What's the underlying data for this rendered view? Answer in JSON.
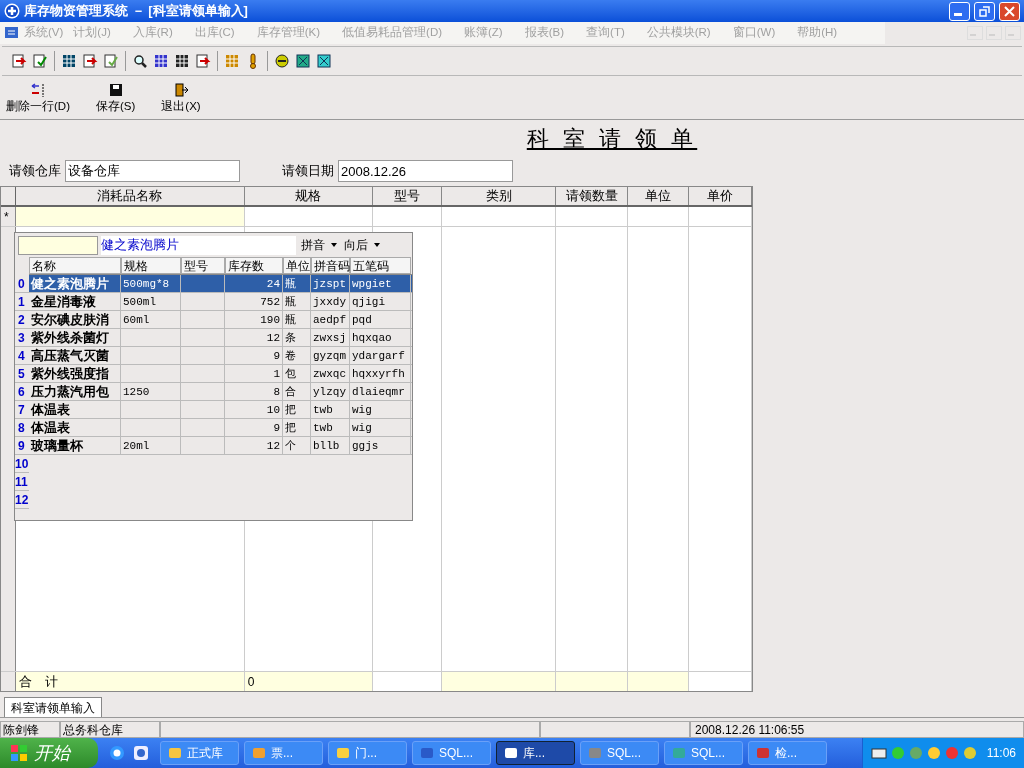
{
  "window": {
    "title": "库存物资管理系统 － [科室请领单输入]"
  },
  "menu": [
    "系统(V)",
    "计划(J)",
    "入库(R)",
    "出库(C)",
    "库存管理(K)",
    "低值易耗品管理(D)",
    "账簿(Z)",
    "报表(B)",
    "查询(T)",
    "公共模块(R)",
    "窗口(W)",
    "帮助(H)"
  ],
  "actions": [
    "删除一行(D)",
    "保存(S)",
    "退出(X)"
  ],
  "form": {
    "title": "科 室 请 领 单",
    "fields": [
      {
        "label": "请领仓库",
        "value": "设备仓库"
      },
      {
        "label": "请领日期",
        "value": "2008.12.26"
      }
    ]
  },
  "grid": {
    "columns": [
      "消耗品名称",
      "规格",
      "型号",
      "类别",
      "请领数量",
      "单位",
      "单价"
    ],
    "new_row_marker": "*",
    "total_label": "合　计",
    "total_value": "0"
  },
  "lookup": {
    "selected_name": "健之素泡腾片",
    "dropdowns": [
      "拼音",
      "向后"
    ],
    "columns": [
      "名称",
      "规格",
      "型号",
      "库存数",
      "单位",
      "拼音码",
      "五笔码"
    ],
    "rows": [
      {
        "index": "0",
        "selected": true,
        "cells": [
          "健之素泡腾片",
          "500mg*8",
          "",
          "24",
          "瓶",
          "jzspt",
          "wpgiet"
        ]
      },
      {
        "index": "1",
        "selected": false,
        "cells": [
          "金星消毒液",
          "500ml",
          "",
          "752",
          "瓶",
          "jxxdy",
          "qjigi"
        ]
      },
      {
        "index": "2",
        "selected": false,
        "cells": [
          "安尔碘皮肤消",
          "60ml",
          "",
          "190",
          "瓶",
          "aedpf",
          "pqd"
        ]
      },
      {
        "index": "3",
        "selected": false,
        "cells": [
          "紫外线杀菌灯",
          "",
          "",
          "12",
          "条",
          "zwxsj",
          "hqxqao"
        ]
      },
      {
        "index": "4",
        "selected": false,
        "cells": [
          "高压蒸气灭菌",
          "",
          "",
          "9",
          "卷",
          "gyzqm",
          "ydargarf"
        ]
      },
      {
        "index": "5",
        "selected": false,
        "cells": [
          "紫外线强度指",
          "",
          "",
          "1",
          "包",
          "zwxqc",
          "hqxxyrfh"
        ]
      },
      {
        "index": "6",
        "selected": false,
        "cells": [
          "压力蒸汽用包",
          "1250",
          "",
          "8",
          "合",
          "ylzqy",
          "dlaieqmr"
        ]
      },
      {
        "index": "7",
        "selected": false,
        "cells": [
          "体温表",
          "",
          "",
          "10",
          "把",
          "twb",
          "wig"
        ]
      },
      {
        "index": "8",
        "selected": false,
        "cells": [
          "体温表",
          "",
          "",
          "9",
          "把",
          "twb",
          "wig"
        ]
      },
      {
        "index": "9",
        "selected": false,
        "cells": [
          "玻璃量杯",
          "20ml",
          "",
          "12",
          "个",
          "bllb",
          "ggjs"
        ]
      }
    ],
    "empty_indexes": [
      "10",
      "11",
      "12"
    ]
  },
  "tabs": [
    {
      "label": "科室请领单输入",
      "selected": true
    }
  ],
  "status_bar": [
    "陈剑锋",
    "总务科仓库",
    "2008.12.26 11:06:55"
  ],
  "taskbar": {
    "start": "开始",
    "tasks": [
      {
        "label": "正式库",
        "selected": false
      },
      {
        "label": "票...",
        "selected": false
      },
      {
        "label": "门...",
        "selected": false
      },
      {
        "label": "SQL...",
        "selected": false
      },
      {
        "label": "库...",
        "selected": true
      },
      {
        "label": "SQL...",
        "selected": false
      },
      {
        "label": "SQL...",
        "selected": false
      },
      {
        "label": "检...",
        "selected": false
      }
    ],
    "clock": "11:06"
  }
}
